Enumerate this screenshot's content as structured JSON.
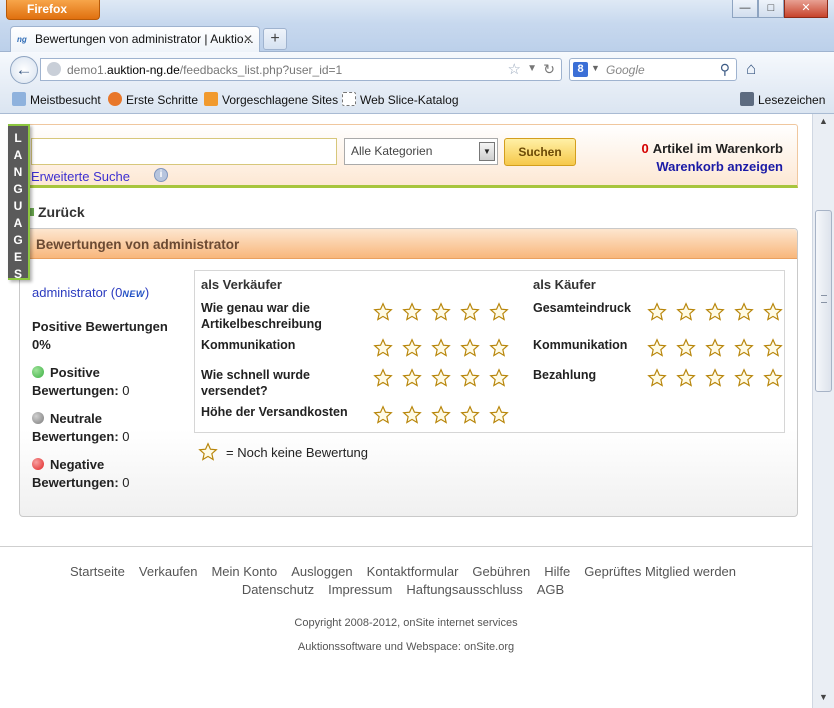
{
  "browser": {
    "app_button": "Firefox",
    "tab_title": "Bewertungen von administrator | Auktio...",
    "tab_favicon_text": "ng",
    "url_prefix": "demo1.",
    "url_domain": "auktion-ng.de",
    "url_path": "/feedbacks_list.php?user_id=1",
    "search_placeholder": "Google",
    "search_engine_letter": "8",
    "bookmarks": [
      "Meistbesucht",
      "Erste Schritte",
      "Vorgeschlagene Sites",
      "Web Slice-Katalog"
    ],
    "bookmarks_menu": "Lesezeichen"
  },
  "languages_tab": [
    "L",
    "A",
    "N",
    "G",
    "U",
    "A",
    "G",
    "E",
    "S"
  ],
  "search": {
    "input_value": "",
    "category": "Alle Kategorien",
    "button": "Suchen",
    "advanced": "Erweiterte Suche",
    "info_icon_text": "i"
  },
  "cart": {
    "count": "0",
    "label": "Artikel im Warenkorb",
    "link": "Warenkorb anzeigen"
  },
  "back_link": "Zurück",
  "panel": {
    "title": "Bewertungen von administrator",
    "user": {
      "name": "administrator",
      "count": "(0",
      "new_badge": "NEW",
      "count_close": ")",
      "positive_heading": "Positive Bewertungen",
      "positive_percent": "0%",
      "positive_label": "Positive",
      "positive_suffix": "Bewertungen:",
      "positive_value": "0",
      "neutral_label": "Neutrale",
      "neutral_suffix": "Bewertungen:",
      "neutral_value": "0",
      "negative_label": "Negative",
      "negative_suffix": "Bewertungen:",
      "negative_value": "0"
    },
    "seller": {
      "heading": "als Verkäufer",
      "criteria": [
        {
          "label_1": "Wie genau war die",
          "label_2": "Artikelbeschreibung",
          "stars": 0
        },
        {
          "label_1": "Kommunikation",
          "label_2": "",
          "stars": 0
        },
        {
          "label_1": "Wie schnell wurde",
          "label_2": "versendet?",
          "stars": 0
        },
        {
          "label_1": "Höhe der Versandkosten",
          "label_2": "",
          "stars": 0
        }
      ]
    },
    "buyer": {
      "heading": "als Käufer",
      "criteria": [
        {
          "label_1": "Gesamteindruck",
          "stars": 0
        },
        {
          "label_1": "Kommunikation",
          "stars": 0
        },
        {
          "label_1": "Bezahlung",
          "stars": 0
        }
      ]
    },
    "legend": "= Noch keine Bewertung"
  },
  "footer": {
    "links_row1": [
      "Startseite",
      "Verkaufen",
      "Mein Konto",
      "Ausloggen",
      "Kontaktformular",
      "Gebühren",
      "Hilfe",
      "Geprüftes Mitglied werden"
    ],
    "links_row2": [
      "Datenschutz",
      "Impressum",
      "Haftungsausschluss",
      "AGB"
    ],
    "copyright": "Copyright 2008-2012, onSite internet services",
    "software": "Auktionssoftware und Webspace: onSite.org"
  },
  "colors": {
    "accent_orange": "#f8b77c",
    "link_blue": "#2b3bbf",
    "positive": "#3cb043",
    "neutral": "#8a8a8a",
    "negative": "#e02424",
    "star_stroke": "#b8860b"
  }
}
